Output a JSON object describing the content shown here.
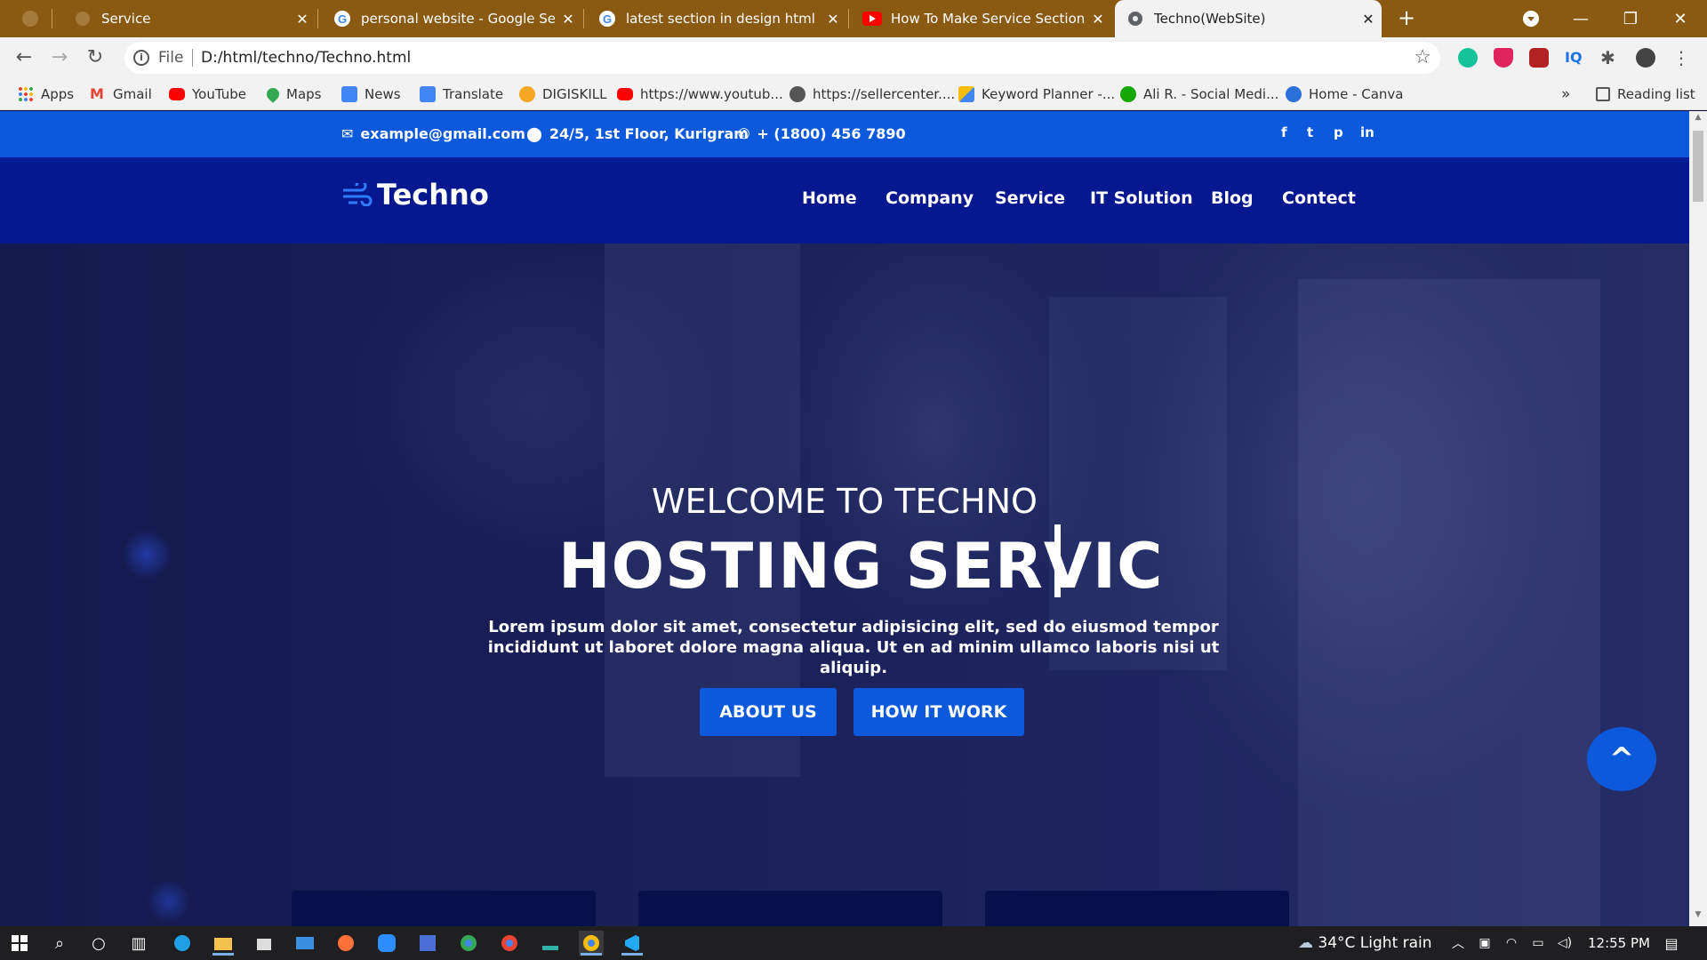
{
  "browser": {
    "tabs": [
      {
        "title": "Service",
        "favicon": "globe-icon",
        "active": false
      },
      {
        "title": "personal website - Google Search",
        "favicon": "google-icon",
        "active": false
      },
      {
        "title": "latest section in design html css",
        "favicon": "google-icon",
        "active": false
      },
      {
        "title": "How To Make Service Section For",
        "favicon": "youtube-icon",
        "active": false
      },
      {
        "title": "Techno(WebSite)",
        "favicon": "globe-icon",
        "active": true
      }
    ],
    "new_tab_label": "+",
    "address": {
      "protocol_label": "File",
      "url": "D:/html/techno/Techno.html"
    },
    "bookmarks": [
      {
        "label": "Apps",
        "icon": "apps-grid-icon"
      },
      {
        "label": "Gmail",
        "icon": "gmail-icon"
      },
      {
        "label": "YouTube",
        "icon": "youtube-icon"
      },
      {
        "label": "Maps",
        "icon": "maps-icon"
      },
      {
        "label": "News",
        "icon": "news-icon"
      },
      {
        "label": "Translate",
        "icon": "translate-icon"
      },
      {
        "label": "DIGISKILL",
        "icon": "digiskill-icon"
      },
      {
        "label": "https://www.youtub...",
        "icon": "youtube-icon"
      },
      {
        "label": "https://sellercenter....",
        "icon": "globe-icon"
      },
      {
        "label": "Keyword Planner -...",
        "icon": "google-ads-icon"
      },
      {
        "label": "Ali R. - Social Medi...",
        "icon": "upwork-icon"
      },
      {
        "label": "Home - Canva",
        "icon": "canva-icon"
      }
    ],
    "bookmarks_overflow": "»",
    "reading_list_label": "Reading list"
  },
  "site": {
    "topbar": {
      "email": "example@gmail.com",
      "address": "24/5, 1st Floor, Kurigram",
      "phone": "+ (1800) 456 7890",
      "social": [
        {
          "glyph": "f",
          "icon": "facebook-icon"
        },
        {
          "glyph": "t",
          "icon": "twitter-icon"
        },
        {
          "glyph": "p",
          "icon": "pinterest-icon"
        },
        {
          "glyph": "in",
          "icon": "linkedin-icon"
        }
      ]
    },
    "logo_text": "Techno",
    "nav": [
      "Home",
      "Company",
      "Service",
      "IT Solution",
      "Blog",
      "Contect"
    ],
    "hero": {
      "welcome": "WELCOME TO TECHNO",
      "headline": "HOSTING SERVIC",
      "lead": "Lorem ipsum dolor sit amet, consectetur adipisicing elit, sed do eiusmod tempor incididunt ut laboret dolore magna aliqua. Ut en ad minim ullamco laboris nisi ut aliquip.",
      "buttons": [
        "ABOUT US",
        "HOW IT WORK"
      ]
    },
    "back_to_top_label": "^"
  },
  "taskbar": {
    "weather": "34°C  Light rain",
    "time": "12:55 PM"
  },
  "colors": {
    "tab_strip": "#8a5a12",
    "topbar_blue": "#0c5adb",
    "navbar_navy": "#06188f",
    "hero_dark": "#1a2058"
  }
}
